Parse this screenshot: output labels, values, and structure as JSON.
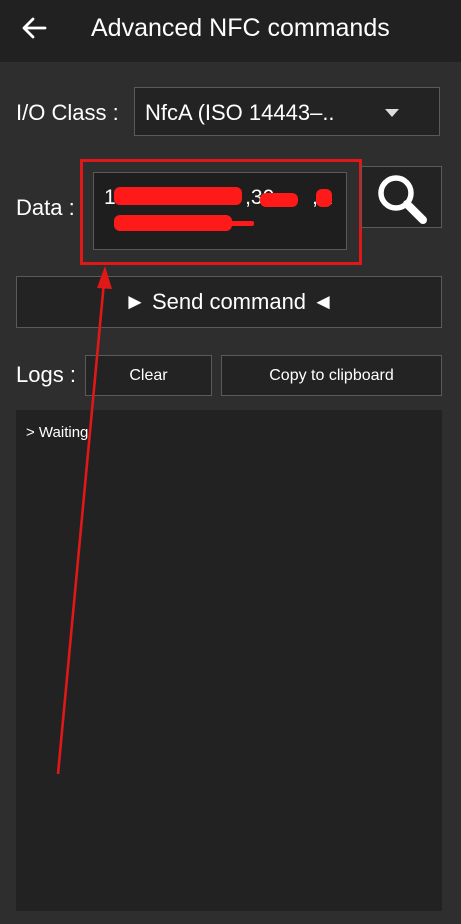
{
  "header": {
    "back_icon": "arrow-left-icon",
    "title": "Advanced NFC commands"
  },
  "io_class": {
    "label": "I/O Class :",
    "selected_value": "NfcA (ISO 14443–..",
    "dropdown_icon": "chevron-down-icon"
  },
  "data_field": {
    "label": "Data :",
    "visible_text": "15                            ,30         ,A    0",
    "redacted": true,
    "search_icon": "search-icon"
  },
  "send": {
    "label": "► Send command ◄"
  },
  "logs": {
    "label": "Logs :",
    "clear_label": "Clear",
    "copy_label": "Copy to clipboard",
    "lines": [
      "> Waiting"
    ]
  },
  "annotation": {
    "highlight_color": "#e01818",
    "redaction_color": "#ff1a1a"
  },
  "colors": {
    "background": "#2e2e2e",
    "appbar": "#212121",
    "control_bg": "#232323",
    "control_border": "#5a5a5a",
    "text": "#ffffff"
  }
}
